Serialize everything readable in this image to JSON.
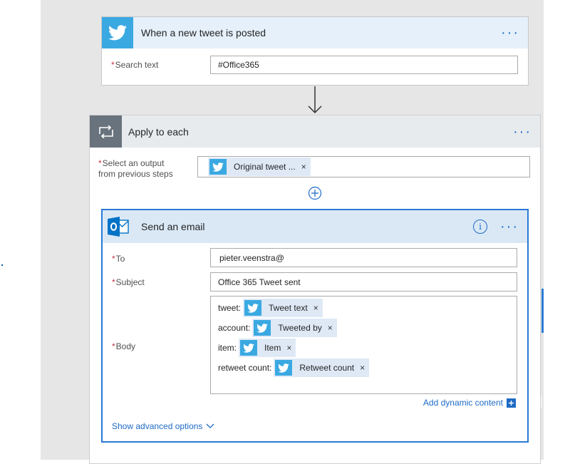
{
  "trigger": {
    "title": "When a new tweet is posted",
    "search_label": "Search text",
    "search_value": "#Office365"
  },
  "loop": {
    "title": "Apply to each",
    "output_label_line1": "Select an output",
    "output_label_line2": "from previous steps",
    "output_token": "Original tweet ..."
  },
  "email": {
    "title": "Send an email",
    "to_label": "To",
    "to_value": "pieter.veenstra@",
    "subject_label": "Subject",
    "subject_value": "Office 365 Tweet sent",
    "body_label": "Body",
    "body_rows": [
      {
        "prefix": "tweet:",
        "token": "Tweet text"
      },
      {
        "prefix": "account:",
        "token": "Tweeted by"
      },
      {
        "prefix": "item:",
        "token": "Item"
      },
      {
        "prefix": "retweet count:",
        "token": "Retweet count"
      }
    ],
    "add_dynamic_label": "Add dynamic content",
    "advanced_label": "Show advanced options"
  },
  "common": {
    "required_mark": "*",
    "remove_mark": "×",
    "more_mark": "···",
    "info_mark": "i"
  },
  "colors": {
    "twitter_blue": "#3aa9e2",
    "loop_gray": "#68737d",
    "outlook_blue": "#0072c6",
    "link_blue": "#1e6bc5",
    "header_tint": "#e5f0fa",
    "required_red": "#c4314b"
  },
  "icons": [
    "twitter-icon",
    "loop-icon",
    "outlook-icon",
    "arrow-down-icon",
    "add-step-icon",
    "info-icon",
    "chevron-down-icon",
    "close-icon"
  ]
}
